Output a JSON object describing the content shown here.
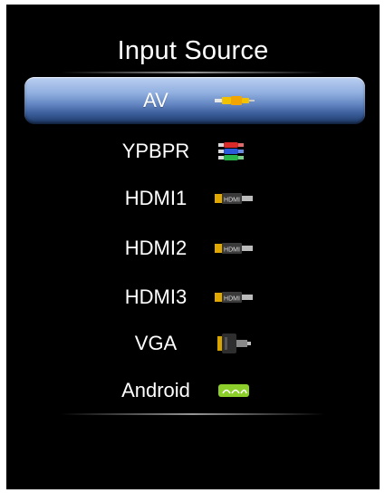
{
  "dialog": {
    "title": "Input Source",
    "items": [
      {
        "label": "AV",
        "icon": "av-composite-cable-icon",
        "selected": true
      },
      {
        "label": "YPBPR",
        "icon": "component-cable-icon",
        "selected": false
      },
      {
        "label": "HDMI1",
        "icon": "hdmi-plug-icon",
        "icon_text": "HDMI",
        "selected": false
      },
      {
        "label": "HDMI2",
        "icon": "hdmi-plug-icon",
        "icon_text": "HDMI",
        "selected": false
      },
      {
        "label": "HDMI3",
        "icon": "hdmi-plug-icon",
        "icon_text": "HDMI",
        "selected": false
      },
      {
        "label": "VGA",
        "icon": "vga-plug-icon",
        "selected": false
      },
      {
        "label": "Android",
        "icon": "android-icon",
        "selected": false
      }
    ]
  },
  "colors": {
    "background": "#000000",
    "selection": "#5f82bf",
    "text": "#ffffff"
  }
}
